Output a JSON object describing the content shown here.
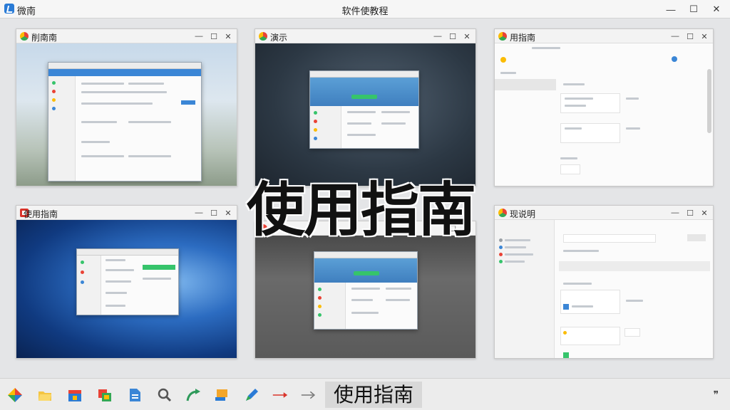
{
  "app": {
    "name": "微南",
    "title": "软件使教程"
  },
  "window_controls": {
    "minimize": "—",
    "maximize": "☐",
    "close": "✕"
  },
  "thumbnails": [
    {
      "title": "削南南",
      "icon": "color-circle-icon"
    },
    {
      "title": "演示",
      "icon": "color-circle-icon"
    },
    {
      "title": "用指南",
      "icon": "color-circle-icon"
    },
    {
      "title": "使用指南",
      "icon": "red-square-icon"
    },
    {
      "title": "",
      "icon": "color-circle-icon"
    },
    {
      "title": "现说明",
      "icon": "color-circle-icon"
    }
  ],
  "overlay": {
    "text": "使用指南"
  },
  "taskbar": {
    "active_label": "使用指南",
    "icons": [
      "diamond-icon",
      "folder-icon",
      "store-icon",
      "gallery-icon",
      "document-icon",
      "search-icon",
      "arrow-curve-icon",
      "paint-icon",
      "pen-icon",
      "red-arrow-icon",
      "gray-arrow-icon"
    ],
    "tray": "❞"
  },
  "colors": {
    "accent": "#2a7bd6",
    "green": "#36c46b",
    "red": "#d9342b"
  }
}
